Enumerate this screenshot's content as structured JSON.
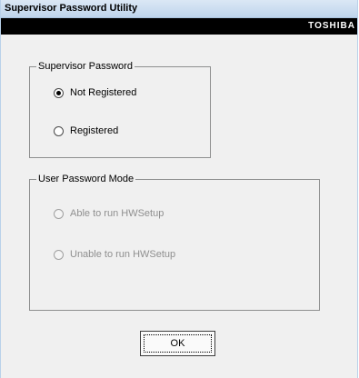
{
  "window": {
    "title": "Supervisor Password Utility",
    "brand": "TOSHIBA"
  },
  "supervisor_password": {
    "legend": "Supervisor Password",
    "options": [
      {
        "label": "Not Registered",
        "checked": true
      },
      {
        "label": "Registered",
        "checked": false
      }
    ]
  },
  "user_password_mode": {
    "legend": "User Password Mode",
    "enabled": false,
    "options": [
      {
        "label": "Able to run HWSetup",
        "checked": false
      },
      {
        "label": "Unable to run HWSetup",
        "checked": false
      }
    ]
  },
  "buttons": {
    "ok_label": "OK"
  }
}
